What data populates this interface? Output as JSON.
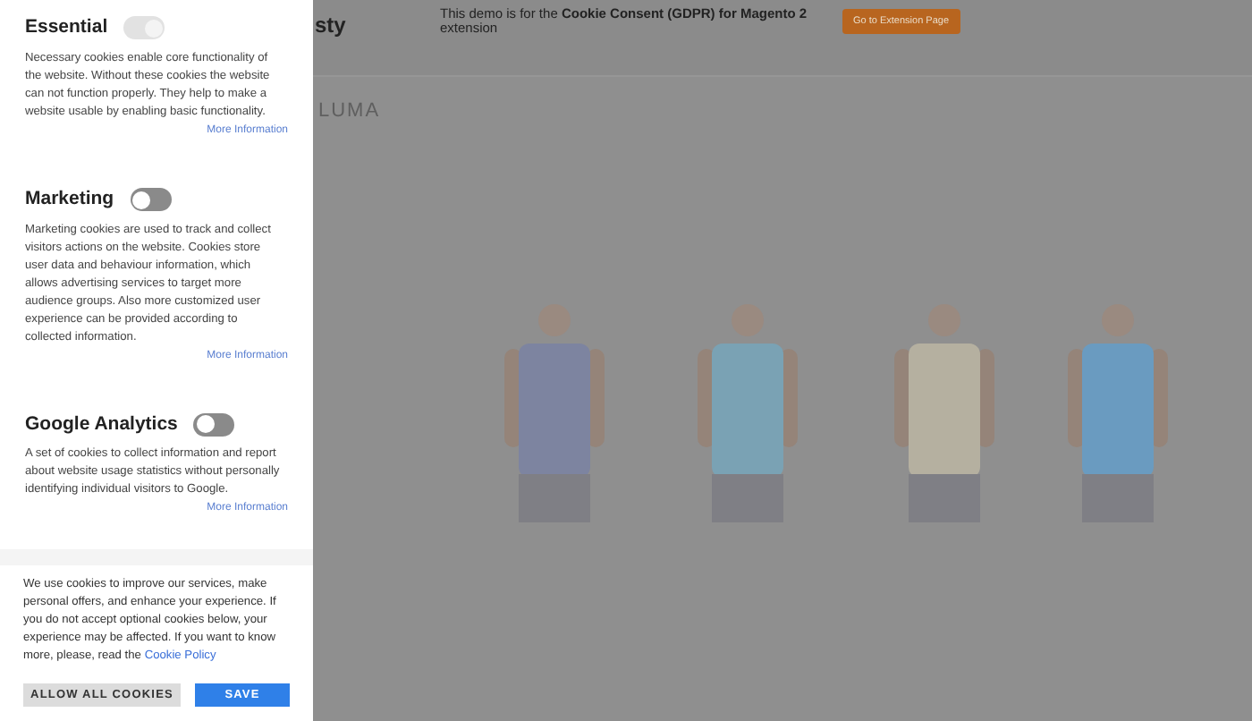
{
  "categories": [
    {
      "title": "Essential",
      "toggle": {
        "checked": true,
        "disabled": true
      },
      "description": "Necessary cookies enable core functionality of the website. Without these cookies the website can not function properly. They help to make a website usable by enabling basic functionality.",
      "link": "More Information"
    },
    {
      "title": "Marketing",
      "toggle": {
        "checked": false,
        "disabled": false
      },
      "description": "Marketing cookies are used to track and collect visitors actions on the website. Cookies store user data and behaviour information, which allows advertising services to target more audience groups. Also more customized user experience can be provided according to collected information.",
      "link": "More Information"
    },
    {
      "title": "Google Analytics",
      "toggle": {
        "checked": false,
        "disabled": false
      },
      "description": "A set of cookies to collect information and report about website usage statistics without personally identifying individual visitors to Google.",
      "link": "More Information"
    }
  ],
  "notice": {
    "text": "We use cookies to improve our services, make personal offers, and enhance your experience. If you do not accept optional cookies below, your experience may be affected. If you want to know more, please, read the",
    "link": "Cookie Policy"
  },
  "buttons": [
    {
      "kind": "secondary",
      "label": "ALLOW ALL COOKIES"
    },
    {
      "kind": "primary",
      "label": "SAVE"
    }
  ],
  "background": {
    "logo": "sty",
    "banner": "This demo is for the **Cookie Consent (GDPR) for Magento 2** extension",
    "banner_button": "Go to Extension Page",
    "store_logo": "LUMA"
  }
}
